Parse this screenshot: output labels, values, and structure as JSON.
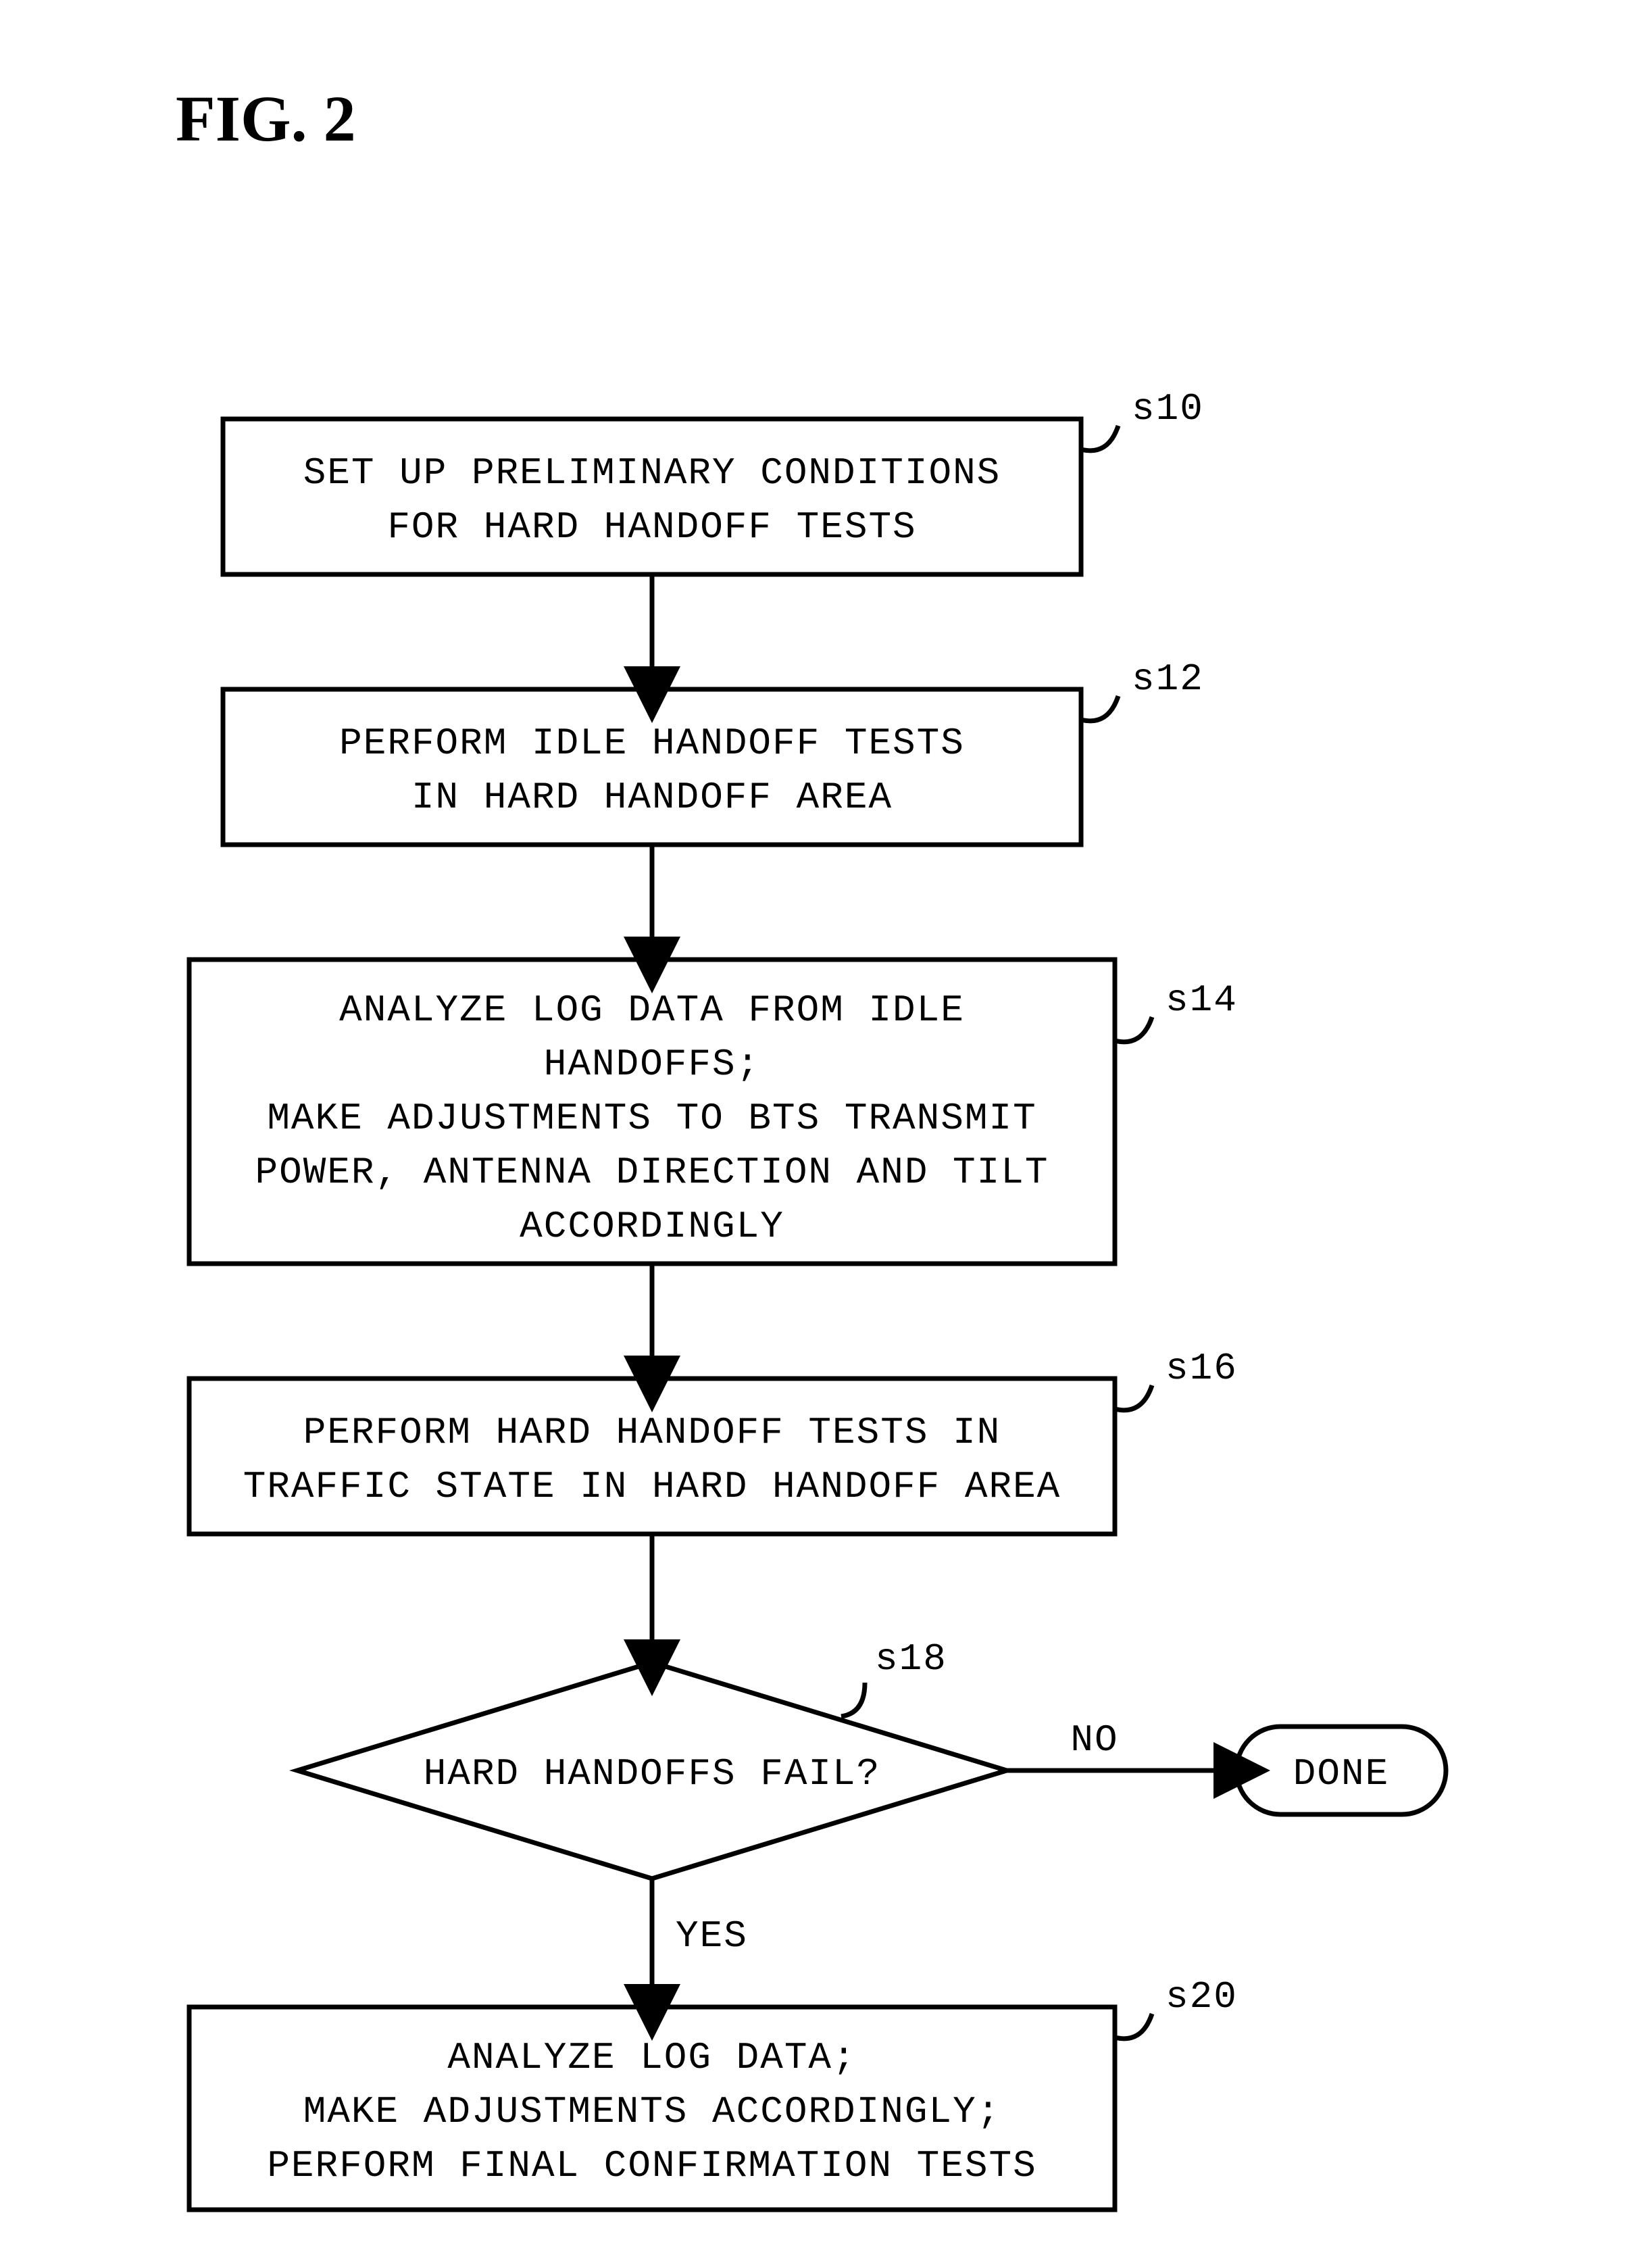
{
  "figure_title": "FIG. 2",
  "nodes": {
    "s10": {
      "label": "s10",
      "lines": [
        "SET UP PRELIMINARY CONDITIONS",
        "FOR HARD HANDOFF TESTS"
      ]
    },
    "s12": {
      "label": "s12",
      "lines": [
        "PERFORM IDLE HANDOFF TESTS",
        "IN HARD HANDOFF AREA"
      ]
    },
    "s14": {
      "label": "s14",
      "lines": [
        "ANALYZE LOG DATA FROM IDLE",
        "HANDOFFS;",
        "MAKE ADJUSTMENTS TO BTS TRANSMIT",
        "POWER, ANTENNA DIRECTION AND TILT",
        "ACCORDINGLY"
      ]
    },
    "s16": {
      "label": "s16",
      "lines": [
        "PERFORM HARD HANDOFF TESTS IN",
        "TRAFFIC STATE IN HARD HANDOFF AREA"
      ]
    },
    "s18": {
      "label": "s18",
      "lines": [
        "HARD HANDOFFS FAIL?"
      ]
    },
    "s20": {
      "label": "s20",
      "lines": [
        "ANALYZE LOG DATA;",
        "MAKE ADJUSTMENTS ACCORDINGLY;",
        "PERFORM FINAL CONFIRMATION TESTS"
      ]
    },
    "done": {
      "lines": [
        "DONE"
      ]
    }
  },
  "edge_labels": {
    "no": "NO",
    "yes": "YES"
  }
}
